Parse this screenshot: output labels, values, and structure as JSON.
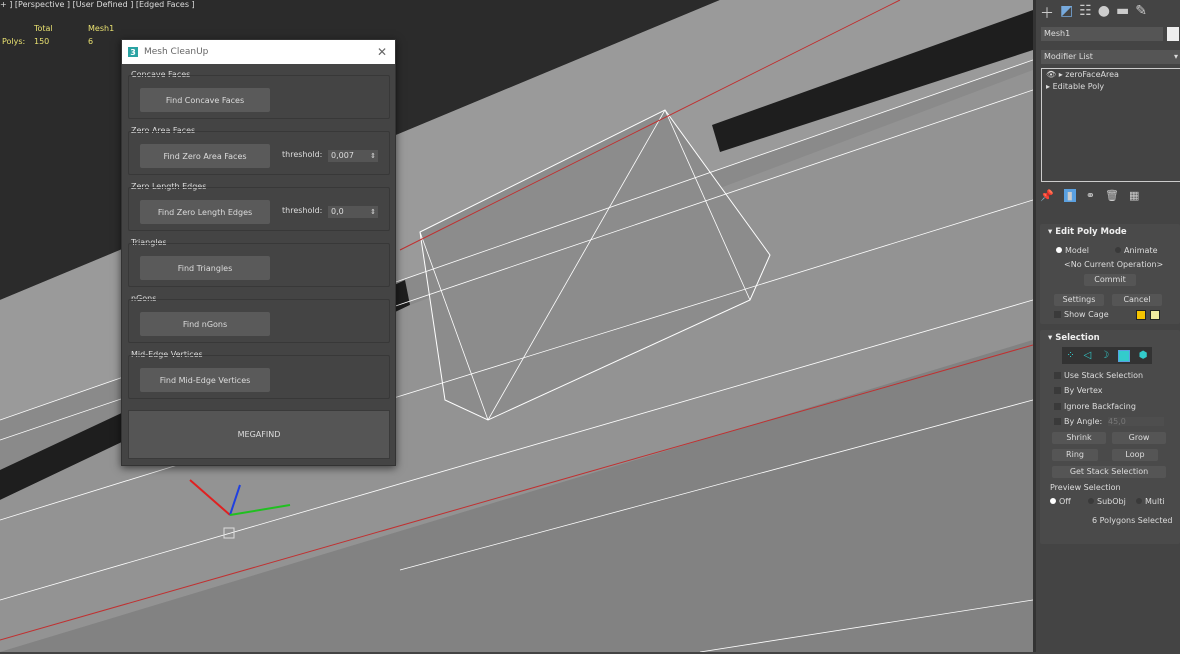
{
  "viewport": {
    "label": "+ ] [Perspective ] [User Defined ] [Edged Faces ]",
    "stats": {
      "col_total": "Total",
      "col_object": "Mesh1",
      "row_label": "Polys:",
      "total": "150",
      "object": "6"
    }
  },
  "dialog": {
    "title": "Mesh CleanUp",
    "close": "✕",
    "logo": "3",
    "groups": [
      {
        "label": "Concave Faces",
        "button": "Find Concave Faces"
      },
      {
        "label": "Zero Area Faces",
        "button": "Find Zero Area Faces",
        "threshold_label": "threshold:",
        "threshold": "0,007"
      },
      {
        "label": "Zero Length Edges",
        "button": "Find Zero Length Edges",
        "threshold_label": "threshold:",
        "threshold": "0,0"
      },
      {
        "label": "Triangles",
        "button": "Find Triangles"
      },
      {
        "label": "nGons",
        "button": "Find nGons"
      },
      {
        "label": "Mid-Edge Vertices",
        "button": "Find Mid-Edge Vertices"
      }
    ],
    "megafind": "MEGAFIND"
  },
  "panel": {
    "object_name": "Mesh1",
    "modifier_list": "Modifier List",
    "stack": [
      "zeroFaceArea",
      "Editable Poly"
    ],
    "edit_poly": {
      "title": "Edit Poly Mode",
      "model": "Model",
      "animate": "Animate",
      "operation": "<No Current Operation>",
      "commit": "Commit",
      "settings": "Settings",
      "cancel": "Cancel",
      "show_cage": "Show Cage",
      "cage_colors": [
        "#f5c400",
        "#f0eaa0"
      ]
    },
    "selection": {
      "title": "Selection",
      "use_stack": "Use Stack Selection",
      "by_vertex": "By Vertex",
      "ignore_backfacing": "Ignore Backfacing",
      "by_angle": "By Angle:",
      "angle": "45,0",
      "shrink": "Shrink",
      "grow": "Grow",
      "ring": "Ring",
      "loop": "Loop",
      "get_stack": "Get Stack Selection",
      "preview": "Preview Selection",
      "off": "Off",
      "subobj": "SubObj",
      "multi": "Multi",
      "status": "6 Polygons Selected"
    },
    "accent": "#5aa0e0"
  }
}
